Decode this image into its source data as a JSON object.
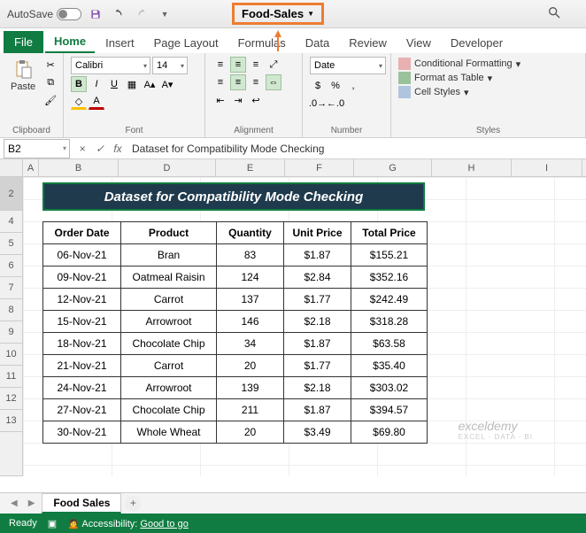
{
  "titlebar": {
    "autosave_label": "AutoSave",
    "autosave_state": "Off",
    "filename": "Food-Sales"
  },
  "tabs": [
    "File",
    "Home",
    "Insert",
    "Page Layout",
    "Formulas",
    "Data",
    "Review",
    "View",
    "Developer"
  ],
  "active_tab": "Home",
  "ribbon": {
    "clipboard": {
      "paste": "Paste",
      "label": "Clipboard"
    },
    "font": {
      "name": "Calibri",
      "size": "14",
      "label": "Font"
    },
    "alignment": {
      "label": "Alignment"
    },
    "number": {
      "format": "Date",
      "label": "Number"
    },
    "styles": {
      "cond": "Conditional Formatting",
      "table": "Format as Table",
      "cell": "Cell Styles",
      "label": "Styles"
    }
  },
  "namebox": "B2",
  "formula": "Dataset for Compatibility Mode Checking",
  "columns": [
    "A",
    "B",
    "D",
    "E",
    "F",
    "G",
    "H",
    "I"
  ],
  "row_nums": [
    "2",
    "4",
    "5",
    "6",
    "7",
    "8",
    "9",
    "10",
    "11",
    "12",
    "13"
  ],
  "data_title": "Dataset for Compatibility Mode Checking",
  "headers": [
    "Order Date",
    "Product",
    "Quantity",
    "Unit Price",
    "Total Price"
  ],
  "rows": [
    [
      "06-Nov-21",
      "Bran",
      "83",
      "$1.87",
      "$155.21"
    ],
    [
      "09-Nov-21",
      "Oatmeal Raisin",
      "124",
      "$2.84",
      "$352.16"
    ],
    [
      "12-Nov-21",
      "Carrot",
      "137",
      "$1.77",
      "$242.49"
    ],
    [
      "15-Nov-21",
      "Arrowroot",
      "146",
      "$2.18",
      "$318.28"
    ],
    [
      "18-Nov-21",
      "Chocolate Chip",
      "34",
      "$1.87",
      "$63.58"
    ],
    [
      "21-Nov-21",
      "Carrot",
      "20",
      "$1.77",
      "$35.40"
    ],
    [
      "24-Nov-21",
      "Arrowroot",
      "139",
      "$2.18",
      "$303.02"
    ],
    [
      "27-Nov-21",
      "Chocolate Chip",
      "211",
      "$1.87",
      "$394.57"
    ],
    [
      "30-Nov-21",
      "Whole Wheat",
      "20",
      "$3.49",
      "$69.80"
    ]
  ],
  "sheet_tab": "Food Sales",
  "status": {
    "ready": "Ready",
    "acc_label": "Accessibility:",
    "acc_value": "Good to go"
  },
  "watermark": {
    "brand": "exceldemy",
    "tag": "EXCEL · DATA · BI"
  },
  "chart_data": {
    "type": "table",
    "title": "Dataset for Compatibility Mode Checking",
    "columns": [
      "Order Date",
      "Product",
      "Quantity",
      "Unit Price",
      "Total Price"
    ],
    "rows": [
      {
        "Order Date": "06-Nov-21",
        "Product": "Bran",
        "Quantity": 83,
        "Unit Price": 1.87,
        "Total Price": 155.21
      },
      {
        "Order Date": "09-Nov-21",
        "Product": "Oatmeal Raisin",
        "Quantity": 124,
        "Unit Price": 2.84,
        "Total Price": 352.16
      },
      {
        "Order Date": "12-Nov-21",
        "Product": "Carrot",
        "Quantity": 137,
        "Unit Price": 1.77,
        "Total Price": 242.49
      },
      {
        "Order Date": "15-Nov-21",
        "Product": "Arrowroot",
        "Quantity": 146,
        "Unit Price": 2.18,
        "Total Price": 318.28
      },
      {
        "Order Date": "18-Nov-21",
        "Product": "Chocolate Chip",
        "Quantity": 34,
        "Unit Price": 1.87,
        "Total Price": 63.58
      },
      {
        "Order Date": "21-Nov-21",
        "Product": "Carrot",
        "Quantity": 20,
        "Unit Price": 1.77,
        "Total Price": 35.4
      },
      {
        "Order Date": "24-Nov-21",
        "Product": "Arrowroot",
        "Quantity": 139,
        "Unit Price": 2.18,
        "Total Price": 303.02
      },
      {
        "Order Date": "27-Nov-21",
        "Product": "Chocolate Chip",
        "Quantity": 211,
        "Unit Price": 1.87,
        "Total Price": 394.57
      },
      {
        "Order Date": "30-Nov-21",
        "Product": "Whole Wheat",
        "Quantity": 20,
        "Unit Price": 3.49,
        "Total Price": 69.8
      }
    ]
  }
}
